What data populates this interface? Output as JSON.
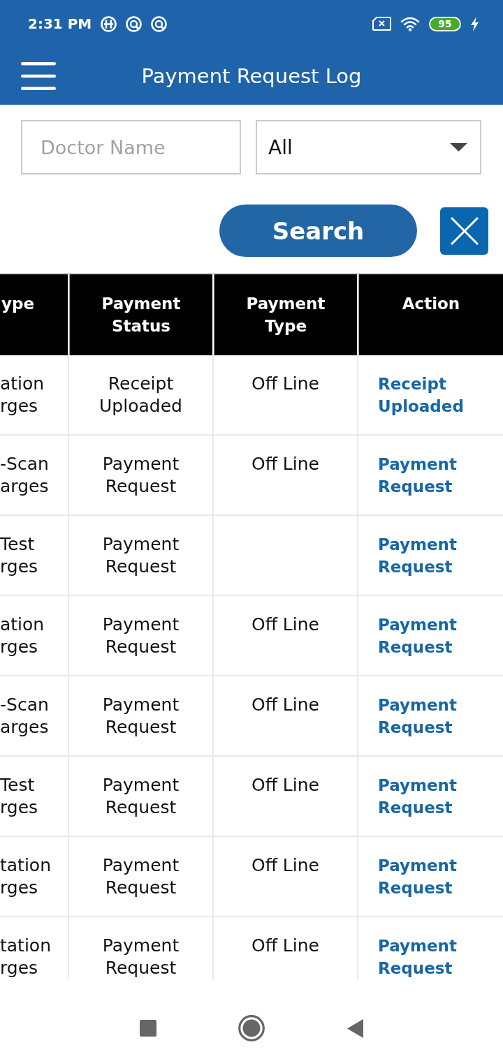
{
  "status_bar": {
    "time": "2:31 PM",
    "battery": "95"
  },
  "app_bar": {
    "title": "Payment Request Log"
  },
  "filters": {
    "doctor_name": {
      "placeholder": "Doctor Name"
    },
    "status": {
      "value": "All"
    }
  },
  "buttons": {
    "search": "Search"
  },
  "table": {
    "columns": [
      "ype",
      "Payment Status",
      "Payment Type",
      "Action"
    ],
    "rows": [
      {
        "column_1": "ation\nrges",
        "payment_status": "Receipt Uploaded",
        "payment_type": "Off Line",
        "action": "Receipt Uploaded"
      },
      {
        "column_1": "-Scan\narges",
        "payment_status": "Payment Request",
        "payment_type": "Off Line",
        "action": "Payment Request"
      },
      {
        "column_1": "Test\nrges",
        "payment_status": "Payment Request",
        "action": "Payment Request"
      },
      {
        "column_1": "ation\nrges",
        "payment_status": "Payment Request",
        "payment_type": "Off Line",
        "action": "Payment Request"
      },
      {
        "column_1": "-Scan\narges",
        "payment_status": "Payment Request",
        "payment_type": "Off Line",
        "action": "Payment Request"
      },
      {
        "column_1": "Test\nrges",
        "payment_status": "Payment Request",
        "payment_type": "Off Line",
        "action": "Payment Request"
      },
      {
        "column_1": "tation\nrges",
        "payment_status": "Payment Request",
        "payment_type": "Off Line",
        "action": "Payment Request"
      },
      {
        "column_1": "tation\nrges",
        "payment_status": "Payment Request",
        "payment_type": "Off Line",
        "action": "Payment Request"
      }
    ]
  }
}
